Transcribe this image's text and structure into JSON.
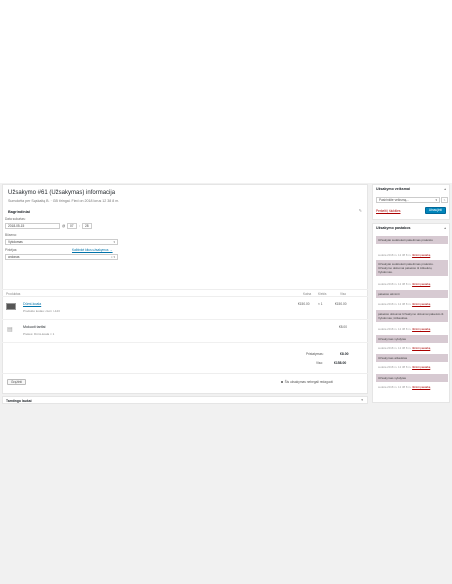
{
  "order": {
    "title": "Užsakymo #61 (Užsakymas) informacija",
    "meta": "Sumokėta per Sąskaitą B. · GB tiringai. Fied on 2018 lorus 12 38 8 m.",
    "general_heading": "Bagrindiniai",
    "date_label": "Data sukurtas:",
    "date_value": "2018-05-15",
    "hour_value": "07",
    "minute_value": "28",
    "status_label": "Būsena:",
    "status_value": "Vykdomas",
    "customer_label": "Pirkėjas:",
    "customer_links": "Kalbinkė kitus užsakymus →",
    "customer_value": "ardonas"
  },
  "items": {
    "col_item": "Produktas",
    "col_cost": "Kaina",
    "col_qty": "Kiekis",
    "col_total": "Viso",
    "rows": [
      {
        "name": "Dümi-koala",
        "sub": "Produkto kodas: ciurn r-123",
        "cost": "€150.00",
        "qty": "× 1",
        "total": "€150.00",
        "kind": "product"
      },
      {
        "name": "Mokuoti tarifai",
        "sub": "Prekės: Dümi-koala × 1",
        "cost": "",
        "qty": "",
        "total": "€8.00",
        "kind": "shipping"
      }
    ],
    "shipping_label": "Pristatymas:",
    "shipping_value": "€8.00",
    "total_label": "Viso:",
    "total_value": "€158.00",
    "refund_button": "Grąžinti",
    "tax_note": "Šis užsakymas nebegali redaguoti"
  },
  "custom_fields": {
    "label": "Tamtingo laukai"
  },
  "actions_box": {
    "title": "Užsakymo veiksmai",
    "select_placeholder": "Pasirinkite veiksmą...",
    "go": ">",
    "trash": "Perkelti į šiukšles",
    "update": "Atnaujinti"
  },
  "notes_box": {
    "title": "Užsakymo pastabos",
    "notes": [
      {
        "text": "Užsakytai sudėtukėti pakeitimas praleistu",
        "meta": "sudėta 2018 m. 12 38 8 m.",
        "del": "Ištrinti pastabą"
      },
      {
        "text": "Užsakytai sudėtukėti pakeitimas praleistu. Užsakymo dokumai pakeisto iš Atšauktų. Vykdomas.",
        "meta": "sudėta 2018 m. 12 38 8 m.",
        "del": "Ištrinti pastabą"
      },
      {
        "text": "pakeisto atiminti",
        "meta": "sudėta 2018 m. 12 38 8 m.",
        "del": "Ištrinti pastabą"
      },
      {
        "text": "pakeisto dokumai Užsakymo dokumai pakeisto iš Vykdomas į Atšauktas.",
        "meta": "sudėta 2018 m. 12 38 8 m.",
        "del": "Ištrinti pastabą"
      },
      {
        "text": "Užsakymas vykdytas",
        "meta": "sudėta 2018 m. 12 38 8 m.",
        "del": "Ištrinti pastabą"
      },
      {
        "text": "Užsakymas atšauktas",
        "meta": "sudėta 2018 m. 12 38 8 m.",
        "del": "Ištrinti pastabą"
      },
      {
        "text": "Užsakymas vykdytas",
        "meta": "sudėta 2018 m. 12 38 8 m.",
        "del": "Ištrinti pastabą"
      }
    ]
  }
}
